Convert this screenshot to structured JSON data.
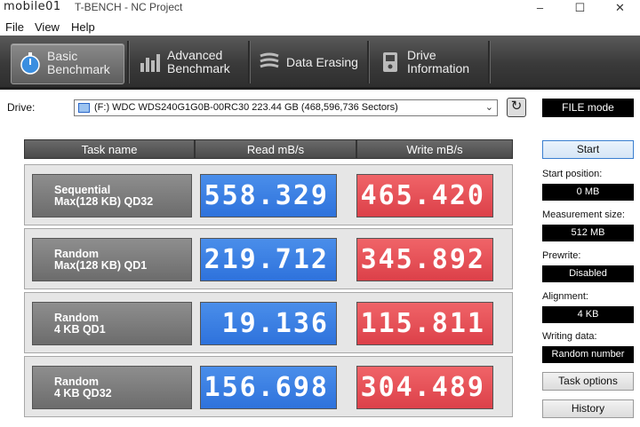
{
  "window": {
    "watermark": "mobile01",
    "title": "T-BENCH - NC Project"
  },
  "menu": [
    "File",
    "View",
    "Help"
  ],
  "tabs": [
    {
      "label": "Basic\nBenchmark",
      "icon": "stopwatch-icon",
      "active": true
    },
    {
      "label": "Advanced\nBenchmark",
      "icon": "bar-chart-icon",
      "active": false
    },
    {
      "label": "Data Erasing",
      "icon": "eraser-icon",
      "active": false
    },
    {
      "label": "Drive\nInformation",
      "icon": "drive-info-icon",
      "active": false
    }
  ],
  "drive": {
    "label": "Drive:",
    "value": "(F:) WDC WDS240G1G0B-00RC30  223.44 GB (468,596,736 Sectors)"
  },
  "file_mode": "FILE mode",
  "table": {
    "headers": [
      "Task name",
      "Read mB/s",
      "Write mB/s"
    ],
    "rows": [
      {
        "task": "Sequential\nMax(128 KB) QD32",
        "read": "558.329",
        "write": "465.420"
      },
      {
        "task": "Random\nMax(128 KB) QD1",
        "read": "219.712",
        "write": "345.892"
      },
      {
        "task": "Random\n4 KB QD1",
        "read": "19.136",
        "write": "115.811"
      },
      {
        "task": "Random\n4 KB QD32",
        "read": "156.698",
        "write": "304.489"
      }
    ]
  },
  "side": {
    "start": "Start",
    "start_position_label": "Start position:",
    "start_position": "0 MB",
    "measurement_label": "Measurement size:",
    "measurement": "512 MB",
    "prewrite_label": "Prewrite:",
    "prewrite": "Disabled",
    "alignment_label": "Alignment:",
    "alignment": "4 KB",
    "writing_label": "Writing data:",
    "writing": "Random number",
    "task_options": "Task options",
    "history": "History"
  }
}
